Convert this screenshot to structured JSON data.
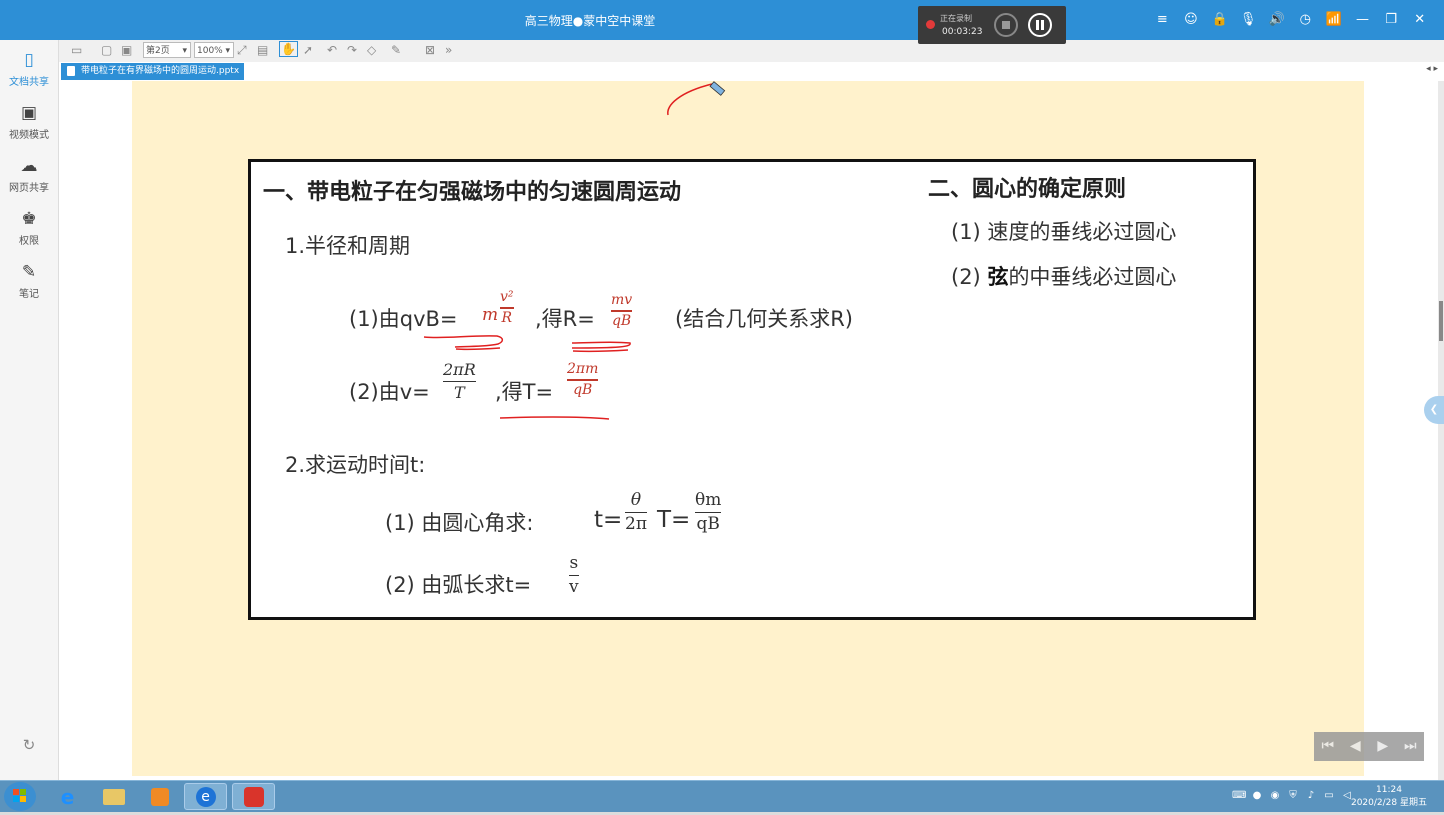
{
  "window": {
    "title": "高三物理●蒙中空中课堂",
    "recording": {
      "status": "正在录制",
      "time": "00:03:23"
    },
    "controls": [
      "≡",
      "☺",
      "🔒",
      "🎙",
      "🔊",
      "◷",
      "📶",
      "—",
      "❐",
      "✕"
    ]
  },
  "sidebar": {
    "items": [
      {
        "label": "文档共享",
        "icon": "document-share-icon",
        "glyph": "▯"
      },
      {
        "label": "视频模式",
        "icon": "video-mode-icon",
        "glyph": "▣"
      },
      {
        "label": "网页共享",
        "icon": "web-share-icon",
        "glyph": "☁"
      },
      {
        "label": "权限",
        "icon": "permission-icon",
        "glyph": "♚"
      },
      {
        "label": "笔记",
        "icon": "note-icon",
        "glyph": "✎"
      }
    ],
    "refresh_glyph": "↻"
  },
  "toolbar": {
    "page_select": "第2页",
    "zoom_select": "100%"
  },
  "tab": {
    "label": "带电粒子在有界磁场中的圆周运动.pptx"
  },
  "tab_arrows": "◂ ▸",
  "slide": {
    "section1_title": "一、带电粒子在匀强磁场中的匀速圆周运动",
    "item1": "1.半径和周期",
    "f1_prefix": "(1)由qvB=",
    "f1_mid": ",得R=",
    "f1_suffix": "(结合几何关系求R)",
    "f1_frac1": {
      "coef": "m",
      "num": "v²",
      "den": "R"
    },
    "f1_frac2": {
      "num": "mv",
      "den": "qB"
    },
    "f2_prefix": "(2)由v=",
    "f2_mid": ",得T=",
    "f2_frac1": {
      "num": "2πR",
      "den": "T"
    },
    "f2_frac2": {
      "num": "2πm",
      "den": "qB"
    },
    "item2": "2.求运动时间t:",
    "t1_prefix": "(1) 由圆心角求:",
    "t1_t": "t=",
    "t1_T": "T=",
    "t1_frac1": {
      "num": "θ",
      "den": "2π"
    },
    "t1_frac2": {
      "num": "θm",
      "den": "qB"
    },
    "t2_prefix": "(2) 由弧长求t=",
    "t2_frac": {
      "num": "s",
      "den": "v"
    },
    "section2_title": "二、圆心的确定原则",
    "rule1": "(1)  速度的垂线必过圆心",
    "rule2_prefix": "(2)",
    "rule2_bold": "弦",
    "rule2_rest": "的中垂线必过圆心"
  },
  "nav": [
    "⏮",
    "◀",
    "▶",
    "⏭"
  ],
  "taskbar": {
    "clock_time": "11:24",
    "clock_date": "2020/2/28 星期五"
  },
  "colors": {
    "title_bar": "#2d8fd6",
    "page_bg": "#fff2cc",
    "annotation": "#e02020"
  }
}
